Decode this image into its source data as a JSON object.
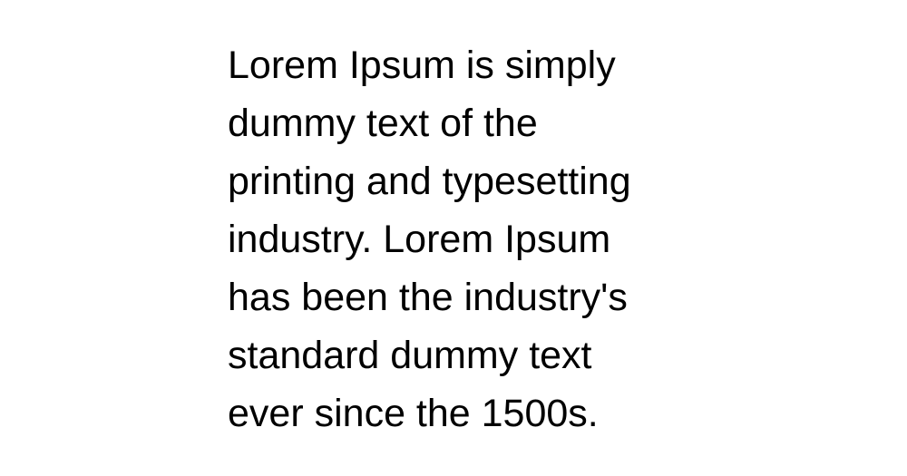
{
  "document": {
    "lines": [
      "Lorem Ipsum is simply",
      "dummy text of the",
      "printing and typesetting",
      "industry. Lorem Ipsum",
      "has been the industry's",
      "standard dummy text",
      "ever since the 1500s."
    ]
  },
  "colors": {
    "background": "#ffffff",
    "text": "#000000"
  }
}
